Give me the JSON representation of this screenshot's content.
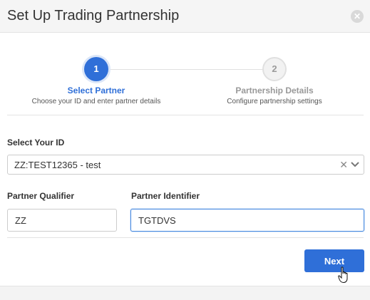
{
  "dialog": {
    "title": "Set Up Trading Partnership"
  },
  "stepper": {
    "steps": [
      {
        "number": "1",
        "title": "Select Partner",
        "description": "Choose your ID and enter partner details",
        "active": true
      },
      {
        "number": "2",
        "title": "Partnership Details",
        "description": "Configure partnership settings",
        "active": false
      }
    ]
  },
  "form": {
    "your_id_label": "Select Your ID",
    "your_id_value": "ZZ:TEST12365 - test",
    "partner_qualifier_label": "Partner Qualifier",
    "partner_qualifier_value": "ZZ",
    "partner_identifier_label": "Partner Identifier",
    "partner_identifier_value": "TGTDVS"
  },
  "actions": {
    "next_label": "Next"
  },
  "icons": {
    "close": "close-icon",
    "clear": "clear-icon",
    "dropdown": "chevron-down-icon",
    "cursor": "hand-pointer-icon"
  },
  "colors": {
    "accent": "#2f6fd8",
    "inactive": "#999999"
  }
}
